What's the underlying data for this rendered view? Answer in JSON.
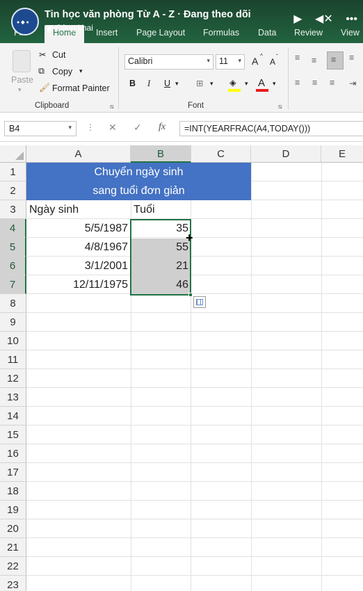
{
  "video_overlay": {
    "channel_title": "Tin học văn phòng Từ A - Z · Đang theo dõi",
    "visibility": "Công khai",
    "play_icon": "play-icon",
    "mute_icon": "speaker-muted-icon",
    "more_icon": "more-icon"
  },
  "ribbon": {
    "tabs": [
      {
        "label": "File"
      },
      {
        "label": "Home",
        "active": true
      },
      {
        "label": "Insert"
      },
      {
        "label": "Page Layout"
      },
      {
        "label": "Formulas"
      },
      {
        "label": "Data"
      },
      {
        "label": "Review"
      },
      {
        "label": "View"
      }
    ],
    "clipboard": {
      "paste": "Paste",
      "cut": "Cut",
      "copy": "Copy",
      "format_painter": "Format Painter",
      "group_label": "Clipboard"
    },
    "font": {
      "family": "Calibri",
      "size": "11",
      "bold": "B",
      "italic": "I",
      "underline": "U",
      "grow": "A",
      "shrink": "A",
      "font_color": "A",
      "group_label": "Font"
    }
  },
  "formula_bar": {
    "name_box": "B4",
    "fx": "fx",
    "formula": "=INT(YEARFRAC(A4,TODAY()))"
  },
  "sheet": {
    "columns": [
      "A",
      "B",
      "C",
      "D",
      "E"
    ],
    "selected_column": "B",
    "rows": [
      "1",
      "2",
      "3",
      "4",
      "5",
      "6",
      "7",
      "8",
      "9",
      "10",
      "11",
      "12",
      "13",
      "14",
      "15",
      "16",
      "17",
      "18",
      "19",
      "20",
      "21",
      "22",
      "23"
    ],
    "title_line1": "Chuyển ngày sinh",
    "title_line2": "sang tuổi đơn giản",
    "header_a": "Ngày sinh",
    "header_b": "Tuổi",
    "data": [
      {
        "dob": "5/5/1987",
        "age": "35"
      },
      {
        "dob": "4/8/1967",
        "age": "55"
      },
      {
        "dob": "3/1/2001",
        "age": "21"
      },
      {
        "dob": "12/11/1975",
        "age": "46"
      }
    ],
    "accent_color": "#217346",
    "title_fill": "#4472c4"
  }
}
